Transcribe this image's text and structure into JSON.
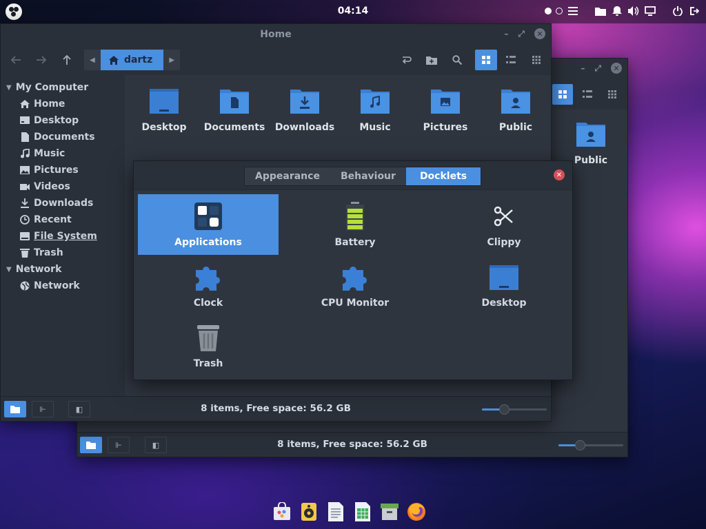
{
  "top_panel": {
    "clock": "04:14"
  },
  "front_window": {
    "title": "Home",
    "breadcrumb": "dartz",
    "sidebar": {
      "sections": [
        {
          "label": "My Computer",
          "items": [
            {
              "label": "Home",
              "icon": "home-icon"
            },
            {
              "label": "Desktop",
              "icon": "desktop-icon"
            },
            {
              "label": "Documents",
              "icon": "document-icon"
            },
            {
              "label": "Music",
              "icon": "music-icon"
            },
            {
              "label": "Pictures",
              "icon": "picture-icon"
            },
            {
              "label": "Videos",
              "icon": "video-icon"
            },
            {
              "label": "Downloads",
              "icon": "download-icon"
            },
            {
              "label": "Recent",
              "icon": "clock-icon"
            },
            {
              "label": "File System",
              "icon": "filesystem-icon"
            },
            {
              "label": "Trash",
              "icon": "trash-icon"
            }
          ]
        },
        {
          "label": "Network",
          "items": [
            {
              "label": "Network",
              "icon": "globe-icon"
            }
          ]
        }
      ]
    },
    "files": [
      {
        "label": "Desktop",
        "icon": "desktop-folder-icon"
      },
      {
        "label": "Documents",
        "icon": "documents-folder-icon"
      },
      {
        "label": "Downloads",
        "icon": "downloads-folder-icon"
      },
      {
        "label": "Music",
        "icon": "music-folder-icon"
      },
      {
        "label": "Pictures",
        "icon": "pictures-folder-icon"
      },
      {
        "label": "Public",
        "icon": "public-folder-icon"
      }
    ],
    "status": "8 items, Free space: 56.2 GB",
    "zoom_level": 0.35
  },
  "back_window": {
    "visible_file": {
      "label": "Public",
      "icon": "public-folder-icon"
    },
    "status": "8 items, Free space: 56.2 GB",
    "zoom_level": 0.35
  },
  "dialog": {
    "tabs": [
      {
        "label": "Appearance",
        "active": false
      },
      {
        "label": "Behaviour",
        "active": false
      },
      {
        "label": "Docklets",
        "active": true
      }
    ],
    "docklets": [
      {
        "label": "Applications",
        "icon": "applications-icon",
        "selected": true
      },
      {
        "label": "Battery",
        "icon": "battery-icon",
        "selected": false
      },
      {
        "label": "Clippy",
        "icon": "scissors-icon",
        "selected": false
      },
      {
        "label": "Clock",
        "icon": "puzzle-icon",
        "selected": false
      },
      {
        "label": "CPU Monitor",
        "icon": "puzzle-icon",
        "selected": false
      },
      {
        "label": "Desktop",
        "icon": "desktop-icon",
        "selected": false
      },
      {
        "label": "Trash",
        "icon": "trash-icon",
        "selected": false
      }
    ]
  },
  "dock": [
    {
      "icon": "software-store-icon"
    },
    {
      "icon": "music-player-icon"
    },
    {
      "icon": "text-editor-icon"
    },
    {
      "icon": "spreadsheet-icon"
    },
    {
      "icon": "archive-manager-icon"
    },
    {
      "icon": "firefox-icon"
    }
  ],
  "colors": {
    "accent": "#4a8fe0",
    "window_bg": "#2f353f",
    "sidebar_bg": "#2a3039",
    "close_red": "#d4505a"
  }
}
